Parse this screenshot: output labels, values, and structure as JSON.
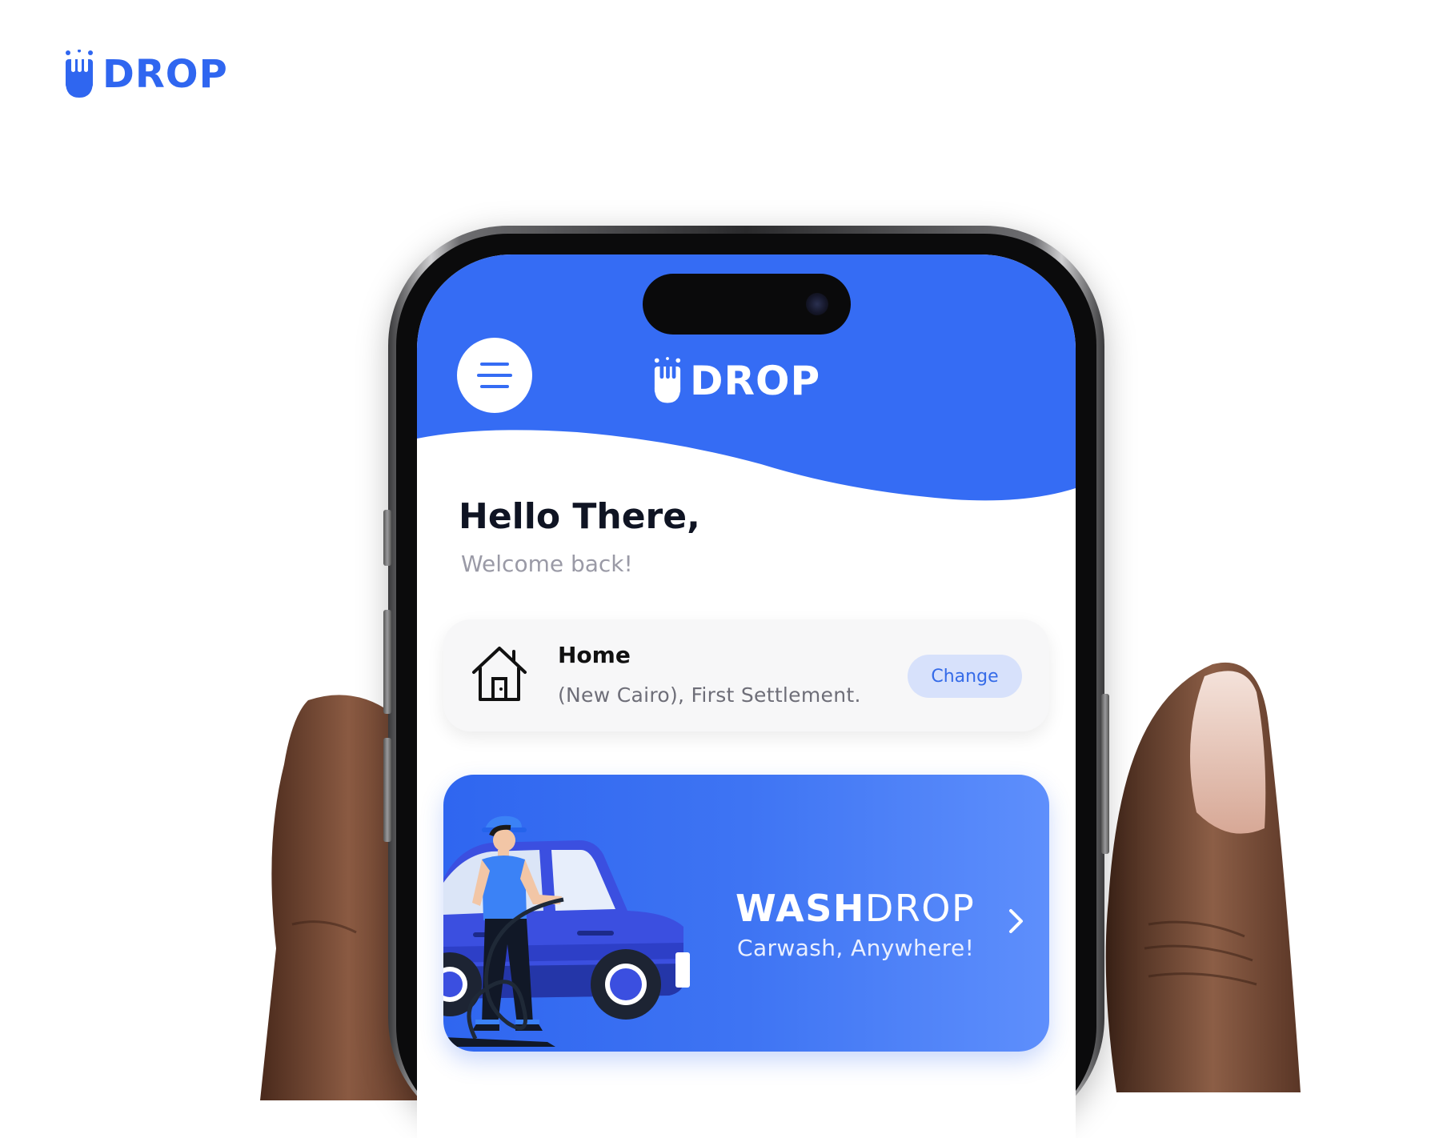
{
  "brand": {
    "name": "DROP",
    "icon": "drop-logo-icon",
    "color": "#2f66f0"
  },
  "app": {
    "header": {
      "menu_icon": "menu-icon",
      "logo_text": "DROP",
      "color": "#356cf4"
    },
    "greeting": {
      "title": "Hello There,",
      "subtitle": "Welcome back!"
    },
    "address_card": {
      "icon": "house-icon",
      "title": "Home",
      "address": "(New Cairo), First Settlement.",
      "change_label": "Change"
    },
    "wash_card": {
      "title_bold": "WASH",
      "title_light": "DROP",
      "subtitle": "Carwash, Anywhere!",
      "arrow_icon": "chevron-right-icon"
    }
  }
}
